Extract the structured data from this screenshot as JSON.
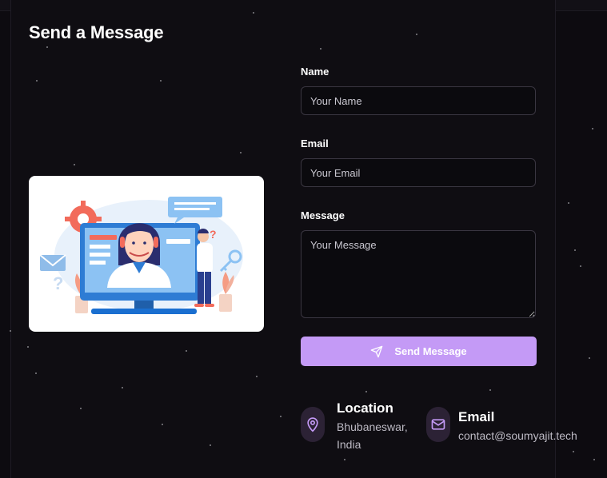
{
  "form": {
    "title": "Send a Message",
    "name_label": "Name",
    "name_placeholder": "Your Name",
    "email_label": "Email",
    "email_placeholder": "Your Email",
    "message_label": "Message",
    "message_placeholder": "Your Message",
    "send_label": "Send Message"
  },
  "contact": {
    "location_title": "Location",
    "location_line1": "Bhubaneswar,",
    "location_line2": "India",
    "email_title": "Email",
    "email_value": "contact@soumyajit.tech"
  },
  "icons": {
    "illustration": "customer-support-illustration",
    "send": "paper-plane-icon",
    "location": "map-pin-icon",
    "email": "envelope-icon"
  },
  "colors": {
    "accent": "#c49af6",
    "background": "#0d0b10",
    "icon_bg": "#2c2235",
    "icon_stroke": "#c49af6"
  }
}
